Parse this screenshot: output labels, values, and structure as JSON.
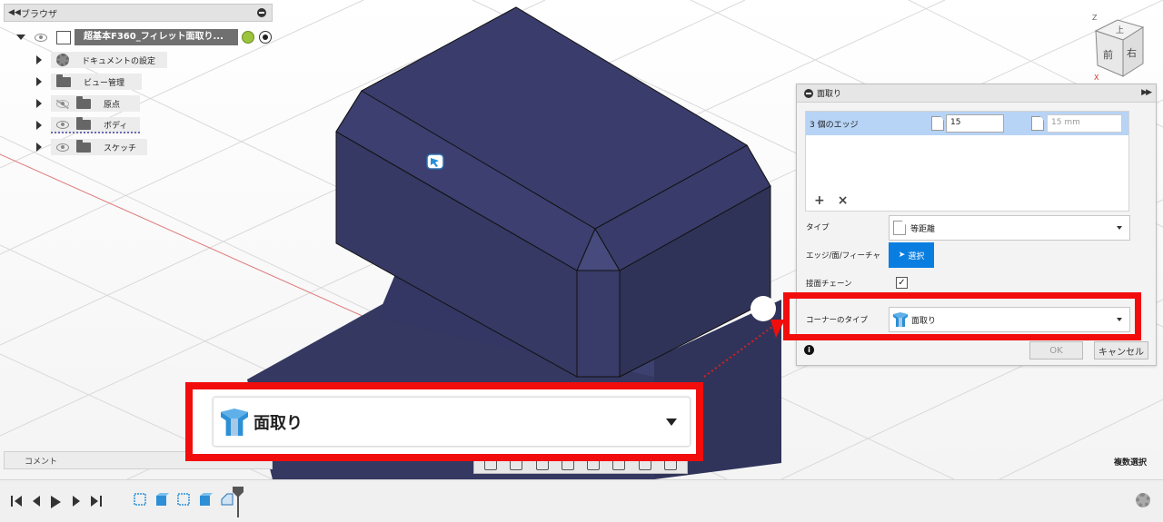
{
  "browser": {
    "title": "ブラウザ",
    "root_label": "超基本F360_フィレット面取り...",
    "items": [
      {
        "label": "ドキュメントの設定"
      },
      {
        "label": "ビュー管理"
      },
      {
        "label": "原点"
      },
      {
        "label": "ボディ"
      },
      {
        "label": "スケッチ"
      }
    ]
  },
  "comment": {
    "label": "コメント"
  },
  "status": {
    "multi_select": "複数選択"
  },
  "viewcube": {
    "top": "上",
    "front": "前",
    "right": "右",
    "axis_z": "Z",
    "axis_x": "X"
  },
  "dialog": {
    "title": "面取り",
    "edges": {
      "count_label": "3 個のエッジ",
      "distance_value": "15",
      "distance_placeholder": "15 mm"
    },
    "type": {
      "label": "タイプ",
      "value": "等距離"
    },
    "edge_face": {
      "label": "エッジ/面/フィーチャ",
      "button": "選択"
    },
    "tangent_chain": {
      "label": "接面チェーン",
      "checked": true,
      "mark": "✓"
    },
    "corner_type": {
      "label": "コーナーのタイプ",
      "value": "面取り"
    },
    "ok": "OK",
    "cancel": "キャンセル",
    "info": "i"
  },
  "zoom_callout": {
    "value": "面取り"
  },
  "colors": {
    "body": "#363963",
    "highlight": "#f20d0d",
    "select_button": "#0a7ee0",
    "edge_row": "#b7d3f5"
  }
}
